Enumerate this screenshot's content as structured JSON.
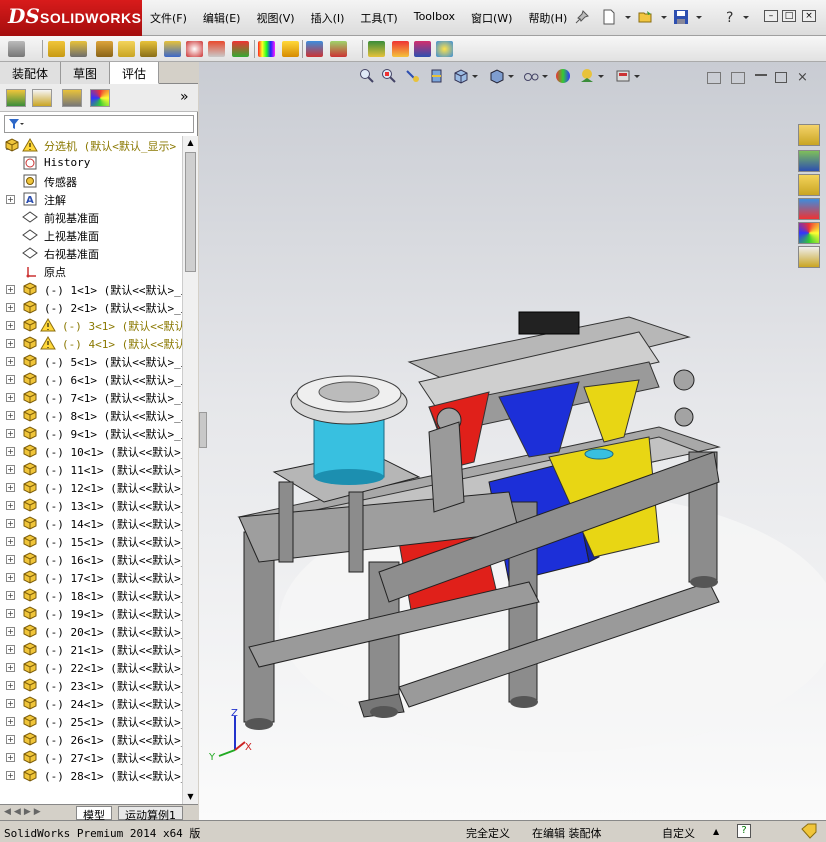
{
  "title_bar": {
    "brand_ds": "DS",
    "brand_name": "SOLIDWORKS",
    "menus": [
      "文件(F)",
      "编辑(E)",
      "视图(V)",
      "插入(I)",
      "工具(T)",
      "Toolbox",
      "窗口(W)",
      "帮助(H)"
    ]
  },
  "left_panel": {
    "tabs": [
      "装配体",
      "草图",
      "评估"
    ],
    "active_tab": "评估",
    "bottom_tabs": [
      "模型",
      "运动算例1"
    ],
    "expand_chevron": "»",
    "tree": [
      {
        "label": "分选机  (默认<默认_显示>",
        "type": "root",
        "warn": true
      },
      {
        "label": "History",
        "type": "history"
      },
      {
        "label": "传感器",
        "type": "sensor"
      },
      {
        "label": "注解",
        "type": "annotation",
        "expand": true
      },
      {
        "label": "前视基准面",
        "type": "plane"
      },
      {
        "label": "上视基准面",
        "type": "plane"
      },
      {
        "label": "右视基准面",
        "type": "plane"
      },
      {
        "label": "原点",
        "type": "origin"
      },
      {
        "label": "(-) 1<1> (默认<<默认>_显",
        "type": "part",
        "expand": true
      },
      {
        "label": "(-) 2<1> (默认<<默认>_显",
        "type": "part",
        "expand": true
      },
      {
        "label": "(-) 3<1> (默认<<默认",
        "type": "part",
        "expand": true,
        "warn": true
      },
      {
        "label": "(-) 4<1> (默认<<默认",
        "type": "part",
        "expand": true,
        "warn": true
      },
      {
        "label": "(-) 5<1> (默认<<默认>_显",
        "type": "part",
        "expand": true
      },
      {
        "label": "(-) 6<1> (默认<<默认>_显",
        "type": "part",
        "expand": true
      },
      {
        "label": "(-) 7<1> (默认<<默认>_显",
        "type": "part",
        "expand": true
      },
      {
        "label": "(-) 8<1> (默认<<默认>_显",
        "type": "part",
        "expand": true
      },
      {
        "label": "(-) 9<1> (默认<<默认>_显",
        "type": "part",
        "expand": true
      },
      {
        "label": "(-) 10<1> (默认<<默认>_",
        "type": "part",
        "expand": true
      },
      {
        "label": "(-) 11<1> (默认<<默认>_",
        "type": "part",
        "expand": true
      },
      {
        "label": "(-) 12<1> (默认<<默认>_",
        "type": "part",
        "expand": true
      },
      {
        "label": "(-) 13<1> (默认<<默认>_",
        "type": "part",
        "expand": true
      },
      {
        "label": "(-) 14<1> (默认<<默认>_",
        "type": "part",
        "expand": true
      },
      {
        "label": "(-) 15<1> (默认<<默认>_",
        "type": "part",
        "expand": true
      },
      {
        "label": "(-) 16<1> (默认<<默认>_",
        "type": "part",
        "expand": true
      },
      {
        "label": "(-) 17<1> (默认<<默认>_",
        "type": "part",
        "expand": true
      },
      {
        "label": "(-) 18<1> (默认<<默认>_",
        "type": "part",
        "expand": true
      },
      {
        "label": "(-) 19<1> (默认<<默认>_",
        "type": "part",
        "expand": true
      },
      {
        "label": "(-) 20<1> (默认<<默认>_",
        "type": "part",
        "expand": true
      },
      {
        "label": "(-) 21<1> (默认<<默认>_",
        "type": "part",
        "expand": true
      },
      {
        "label": "(-) 22<1> (默认<<默认>_",
        "type": "part",
        "expand": true
      },
      {
        "label": "(-) 23<1> (默认<<默认>_",
        "type": "part",
        "expand": true
      },
      {
        "label": "(-) 24<1> (默认<<默认>_",
        "type": "part",
        "expand": true
      },
      {
        "label": "(-) 25<1> (默认<<默认>_",
        "type": "part",
        "expand": true
      },
      {
        "label": "(-) 26<1> (默认<<默认>_",
        "type": "part",
        "expand": true
      },
      {
        "label": "(-) 27<1> (默认<<默认>_",
        "type": "part",
        "expand": true
      },
      {
        "label": "(-) 28<1> (默认<<默认>_",
        "type": "part",
        "expand": true
      }
    ]
  },
  "status_bar": {
    "product": "SolidWorks Premium 2014 x64 版",
    "definition": "完全定义",
    "mode": "在编辑 装配体",
    "units": "自定义",
    "units_arrow": "▲"
  },
  "triad": {
    "x": "X",
    "y": "Y",
    "z": "Z"
  },
  "colors": {
    "frame": "#8c8c8c",
    "red_bin": "#e0201a",
    "blue_bin": "#1c2fd8",
    "yellow_bin": "#e8d614",
    "cyan_bowl": "#38c0e0"
  }
}
